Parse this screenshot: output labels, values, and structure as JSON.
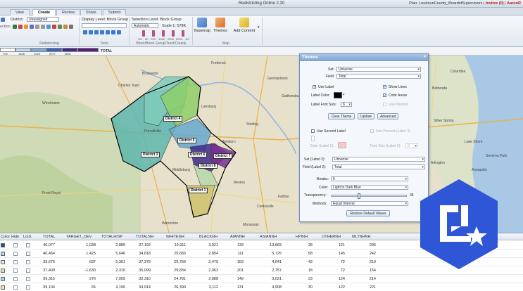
{
  "titlebar": {
    "app_title": "Redistricting Online 2.30",
    "plan_prefix": "Plan:",
    "plan_name": "LoudounCounty_BoardofSupervisors",
    "invites": "Invites (0)",
    "user": "AaronR"
  },
  "tabs": [
    "View",
    "Create",
    "Review",
    "Share",
    "Submit"
  ],
  "active_tab": "Create",
  "ribbon": {
    "district_label": "District:",
    "district_value": "Unassigned",
    "display_level_label": "Display Level: Block Group",
    "selection_level_label": "Selection Level: Block Group",
    "automatic_value": "Automatic",
    "scale_label": "Scale 1: 578K",
    "scale_ticks": [
      "1M",
      "5K",
      "20K",
      "100K",
      "250K",
      "500K",
      "1M"
    ],
    "basemap_label": "Basemap",
    "themes_label": "Themes",
    "add_content_label": "Add Content",
    "group_redistricting": "Redistricting",
    "group_tools": "Tools",
    "group_geography": "Block/Block Group/Tract/County",
    "group_map": "Map",
    "side_label": "ection"
  },
  "legend": {
    "labels": [
      "TOTAL",
      "709",
      "1538",
      "2323",
      "2977",
      "3891"
    ],
    "colors": [
      "#ffffff",
      "#bcd7ee",
      "#7ea9d8",
      "#3c63b8",
      "#3b2a8c",
      "#5a1d7a"
    ]
  },
  "map": {
    "places": [
      "Brunswick",
      "Charles Town",
      "Leesburg",
      "Sterling",
      "Reston",
      "Ashburn",
      "Purcellville",
      "Front Royal",
      "Warrenton",
      "Manassas",
      "Centreville",
      "Fairfax",
      "Bethesda",
      "Germantown",
      "Gaithersburg",
      "Silver Spring",
      "Lake Shore",
      "Annapolis",
      "Middleburg",
      "Winchester",
      "Frederick",
      "Columbia",
      "Severna Park",
      "Arlington"
    ],
    "districts": [
      "District 4",
      "District 5",
      "District 3",
      "District 6",
      "District 7",
      "District 8",
      "District 1"
    ]
  },
  "themes_dialog": {
    "title": "Themes",
    "close_glyph": "×",
    "set_label": "Set:",
    "set_value": "Universe",
    "field_label": "Field:",
    "field_value": "Total",
    "use_label": "Use Label",
    "show_lines": "Show Lines",
    "label_color": "Label Color:",
    "color_areas": "Color Areas",
    "label_font_size": "Label Font Size:",
    "font_size_value": "6",
    "use_percent": "Use Percent",
    "btn_clear": "Clear Theme",
    "btn_update": "Update",
    "btn_advanced": "Advanced",
    "use_second_label": "Use Second Label",
    "use_percent_label2": "Use Percent (Label 2)",
    "color_label2": "Color (Label 2):",
    "font_size_label2": "Font Size (Label 2):",
    "font_size_label2_value": "6",
    "set_label2": "Set (Label 2):",
    "set_label2_value": "Universe",
    "field_label2": "Field (Label 2):",
    "field_label2_value": "Total",
    "breaks_label": "Breaks:",
    "breaks_value": "5",
    "color_label": "Color:",
    "color_value": "Light to Dark Blue",
    "transparency_label": "Transparency:",
    "transparency_value": "36",
    "transparency_fraction": 0.36,
    "methods_label": "Methods:",
    "methods_value": "Equal Interval",
    "btn_restore": "Restore Default Values"
  },
  "grid": {
    "columns": [
      "Color",
      "Hide",
      "Lock",
      "TOTAL",
      "TARGET_DEV",
      "TOTALHISP",
      "TOTALNH",
      "WHITENH",
      "BLACKNH",
      "AIANNH",
      "ASIANNH",
      "HPINH",
      "OTHERNH",
      "MLTNHNH"
    ],
    "rows": [
      {
        "color": "#1f4e9a",
        "values": [
          "40,077",
          "1,038",
          "2,885",
          "37,192",
          "19,911",
          "3,021",
          "133",
          "13,683",
          "28",
          "121",
          "295"
        ]
      },
      {
        "color": "#b8d4ec",
        "values": [
          "40,464",
          "1,425",
          "5,646",
          "34,818",
          "25,683",
          "2,854",
          "111",
          "5,725",
          "58",
          "145",
          "242"
        ]
      },
      {
        "color": "#d9efd0",
        "values": [
          "39,676",
          "637",
          "2,301",
          "37,375",
          "29,759",
          "2,479",
          "163",
          "4,641",
          "42",
          "72",
          "219"
        ]
      },
      {
        "color": "#cde9a5",
        "values": [
          "37,409",
          "-1,630",
          "2,310",
          "35,099",
          "29,834",
          "2,063",
          "201",
          "2,757",
          "18",
          "72",
          "154"
        ]
      },
      {
        "color": "#a6dbd3",
        "values": [
          "39,315",
          "276",
          "7,005",
          "32,310",
          "24,781",
          "2,888",
          "149",
          "3,021",
          "23",
          "124",
          "214"
        ]
      },
      {
        "color": "#f1e3a3",
        "values": [
          "39,104",
          "65",
          "4,190",
          "34,914",
          "26,390",
          "3,112",
          "131",
          "4,908",
          "30",
          "122",
          "221"
        ]
      }
    ]
  }
}
